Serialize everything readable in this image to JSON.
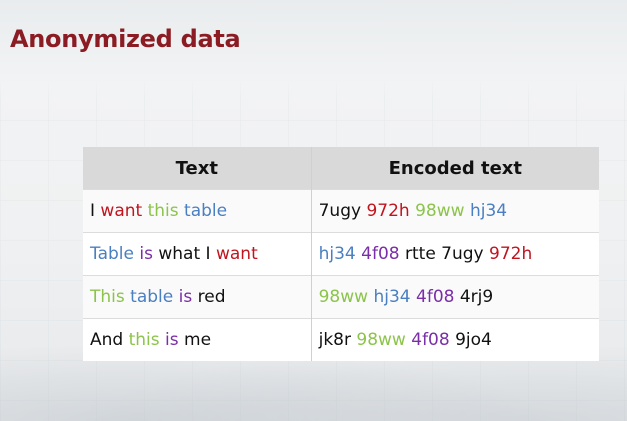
{
  "title": "Anonymized data",
  "colors": {
    "title": "#8b1c24",
    "red": "#c0141f",
    "green": "#8cc44b",
    "blue": "#4a7fc1",
    "purple": "#7a2ea8",
    "header_bg": "#d9d9d9"
  },
  "table": {
    "headers": [
      "Text",
      "Encoded text"
    ],
    "rows": [
      {
        "text": [
          [
            "I ",
            "black"
          ],
          [
            "want",
            "red"
          ],
          [
            " ",
            "black"
          ],
          [
            "this",
            "green"
          ],
          [
            " ",
            "black"
          ],
          [
            "table",
            "blue"
          ]
        ],
        "encoded": [
          [
            "7ugy ",
            "black"
          ],
          [
            "972h",
            "red"
          ],
          [
            " ",
            "black"
          ],
          [
            "98ww",
            "green"
          ],
          [
            " ",
            "black"
          ],
          [
            "hj34",
            "blue"
          ]
        ]
      },
      {
        "text": [
          [
            "Table",
            "blue"
          ],
          [
            " ",
            "black"
          ],
          [
            "is",
            "purple"
          ],
          [
            " what I ",
            "black"
          ],
          [
            "want",
            "red"
          ]
        ],
        "encoded": [
          [
            "hj34",
            "blue"
          ],
          [
            " ",
            "black"
          ],
          [
            "4f08",
            "purple"
          ],
          [
            " rtte 7ugy ",
            "black"
          ],
          [
            "972h",
            "red"
          ]
        ]
      },
      {
        "text": [
          [
            "This",
            "green"
          ],
          [
            " ",
            "black"
          ],
          [
            "table",
            "blue"
          ],
          [
            " ",
            "black"
          ],
          [
            "is",
            "purple"
          ],
          [
            " red",
            "black"
          ]
        ],
        "encoded": [
          [
            "98ww",
            "green"
          ],
          [
            " ",
            "black"
          ],
          [
            "hj34",
            "blue"
          ],
          [
            " ",
            "black"
          ],
          [
            "4f08",
            "purple"
          ],
          [
            " 4rj9",
            "black"
          ]
        ]
      },
      {
        "text": [
          [
            "And ",
            "black"
          ],
          [
            "this",
            "green"
          ],
          [
            " ",
            "black"
          ],
          [
            "is",
            "purple"
          ],
          [
            " me",
            "black"
          ]
        ],
        "encoded": [
          [
            "jk8r ",
            "black"
          ],
          [
            "98ww",
            "green"
          ],
          [
            " ",
            "black"
          ],
          [
            "4f08",
            "purple"
          ],
          [
            " 9jo4",
            "black"
          ]
        ]
      }
    ]
  }
}
